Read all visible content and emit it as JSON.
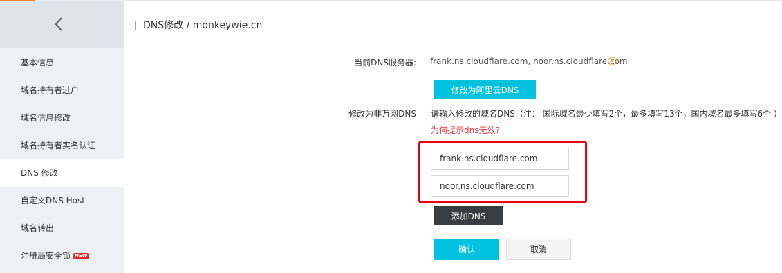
{
  "sidebar": {
    "back_icon": "chevron-left-icon",
    "items": [
      {
        "label": "基本信息"
      },
      {
        "label": "域名持有者过户"
      },
      {
        "label": "域名信息修改"
      },
      {
        "label": "域名持有者实名认证"
      },
      {
        "label": "DNS 修改",
        "active": true
      },
      {
        "label": "自定义DNS Host"
      },
      {
        "label": "域名转出"
      },
      {
        "label": "注册局安全锁",
        "badge": "NEW"
      }
    ]
  },
  "header": {
    "title": "DNS修改 / monkeywie.cn"
  },
  "current_dns": {
    "label": "当前DNS服务器:",
    "value": "frank.ns.cloudflare.com, noor.ns.cloudflare.com",
    "info_icon": "warning-circle-icon"
  },
  "switch_aliyun_button": "修改为阿里云DNS",
  "modify_section": {
    "label": "修改为非万网DNS",
    "instruction": "请输入修改的域名DNS（注： 国际域名最少填写2个，最多填写13个，国内域名最多填写6个 ）",
    "tip_link": "为何提示dns无效?"
  },
  "dns_inputs": [
    {
      "value": "frank.ns.cloudflare.com"
    },
    {
      "value": "noor.ns.cloudflare.com"
    }
  ],
  "add_dns_button": "添加DNS",
  "confirm_button": "确认",
  "cancel_button": "取消",
  "colors": {
    "accent_teal": "#00c1de",
    "dark_button": "#373d41",
    "highlight_red": "#e60012",
    "warning_orange": "#f5a623",
    "tip_red": "#e4393c"
  }
}
